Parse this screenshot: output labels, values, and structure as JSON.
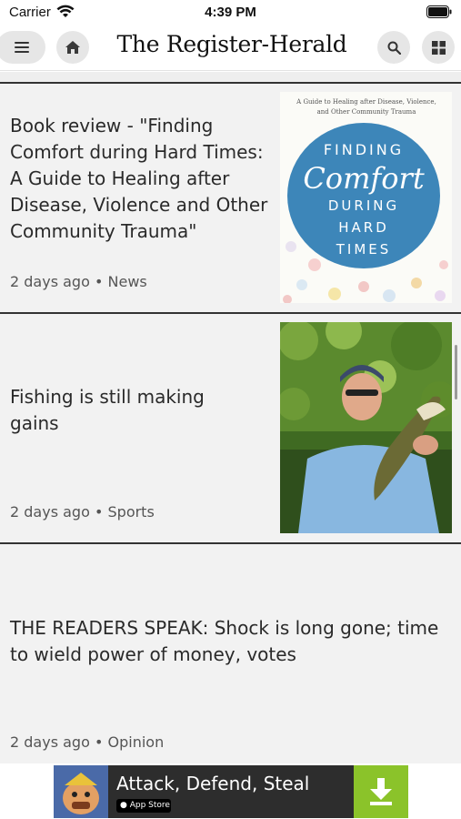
{
  "status_bar": {
    "carrier": "Carrier",
    "time": "4:39 PM"
  },
  "header": {
    "masthead": "The Register-Herald",
    "icons": [
      "menu-icon",
      "home-icon",
      "search-icon",
      "grid-icon"
    ]
  },
  "articles": [
    {
      "headline": "Book review - \"Finding Comfort during Hard Times: A Guide to Healing after Disease, Violence and Other Community Trauma\"",
      "time": "2 days ago",
      "section": "News",
      "thumb": {
        "kicker": "A Guide to Healing after Disease, Violence, and Other Community Trauma",
        "line1": "FINDING",
        "script": "Comfort",
        "line2": "DURING",
        "line3": "HARD",
        "line4": "TIMES"
      }
    },
    {
      "headline": "Fishing is still making gains",
      "time": "2 days ago",
      "section": "Sports"
    },
    {
      "headline": "THE READERS SPEAK: Shock is long gone; time to wield power of money, votes",
      "time": "2 days ago",
      "section": "Opinion"
    }
  ],
  "ad": {
    "title": "Attack, Defend, Steal",
    "store_badge": "App Store"
  },
  "colors": {
    "background": "#eeeeee",
    "book_circle": "#3d86b9",
    "ad_download": "#8bc32a"
  }
}
